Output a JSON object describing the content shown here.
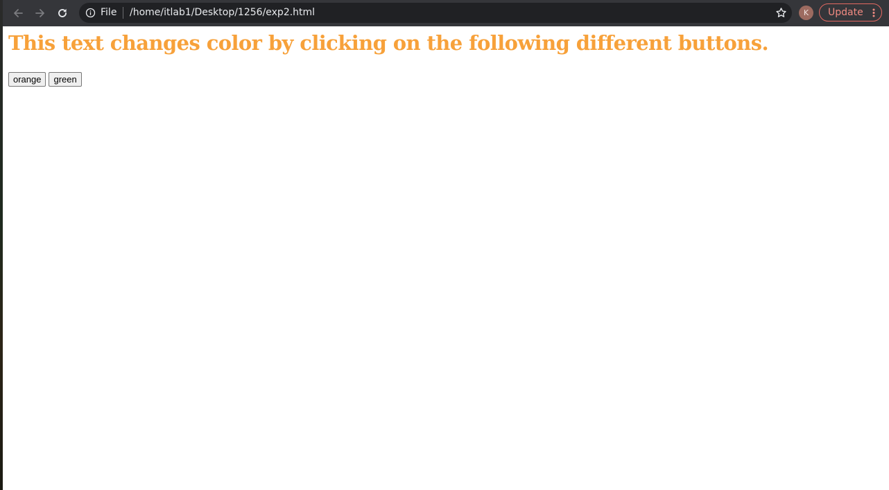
{
  "browser": {
    "scheme_label": "File",
    "url": "/home/itlab1/Desktop/1256/exp2.html",
    "profile_initial": "K",
    "update_label": "Update",
    "icons": [
      "back-icon",
      "forward-icon",
      "reload-icon",
      "info-icon",
      "star-icon",
      "more-icon"
    ]
  },
  "page": {
    "heading": "This text changes color by clicking on the following different buttons.",
    "heading_color": "#f7a13a",
    "buttons": [
      {
        "label": "orange",
        "color": "#f7a13a"
      },
      {
        "label": "green",
        "color": "#008000"
      }
    ]
  }
}
